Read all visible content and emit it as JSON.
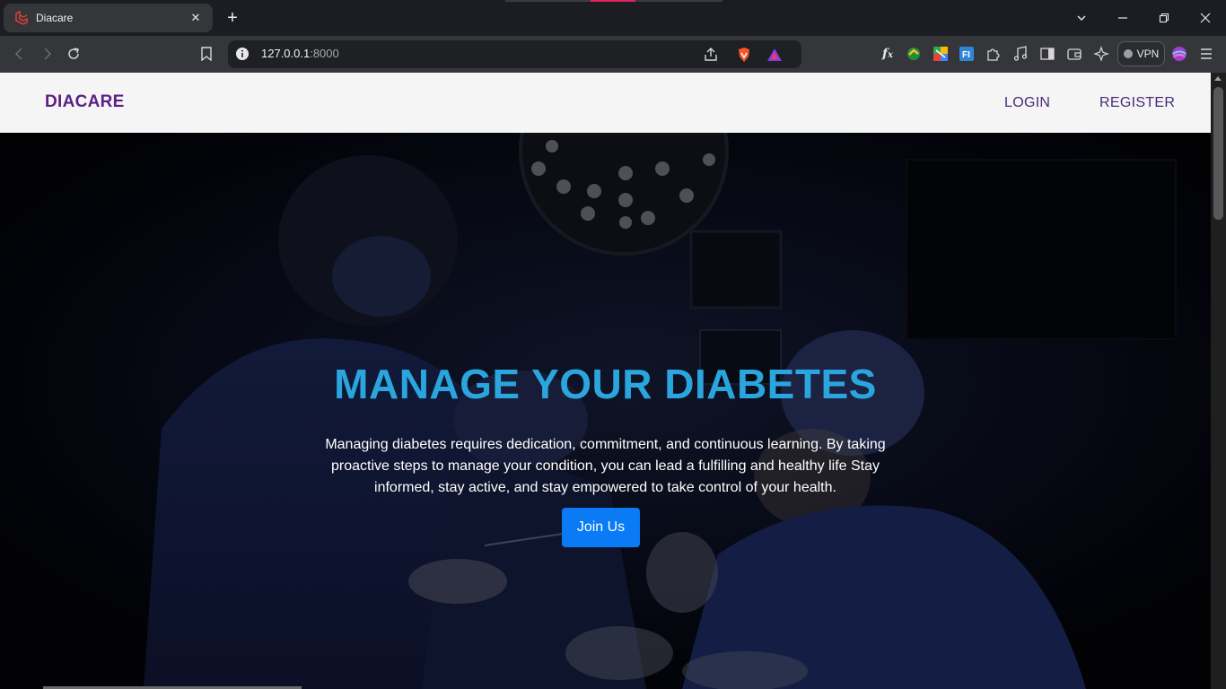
{
  "browser": {
    "tab": {
      "title": "Diacare",
      "close": "✕"
    },
    "new_tab": "+",
    "window_controls": [
      "chevron-down",
      "minimize",
      "restore",
      "close"
    ],
    "address": {
      "host": "127.0.0.1",
      "port": ":8000"
    },
    "vpn_label": "VPN",
    "toolbar_icons": [
      "back-icon",
      "forward-icon",
      "reload-icon",
      "bookmark-icon",
      "share-icon",
      "brave-shield-icon",
      "brave-rewards-icon",
      "fx-extension-icon",
      "extension-icon",
      "color-extension-icon",
      "fi-extension-icon",
      "puzzle-icon",
      "music-icon",
      "sidebar-icon",
      "wallet-icon",
      "leo-ai-icon",
      "profile-icon",
      "menu-icon"
    ]
  },
  "page": {
    "brand": "DIACARE",
    "nav": {
      "login": "LOGIN",
      "register": "REGISTER"
    },
    "hero": {
      "title": "MANAGE YOUR DIABETES",
      "text": "Managing diabetes requires dedication, commitment, and continuous learning. By taking proactive steps to manage your condition, you can lead a fulfilling and healthy life Stay informed, stay active, and stay empowered to take control of your health.",
      "button": "Join Us"
    }
  },
  "colors": {
    "brand": "#5b1f86",
    "hero_title": "#2aa5dd",
    "button": "#0a7af5",
    "navbar_bg": "#f5f5f5"
  }
}
